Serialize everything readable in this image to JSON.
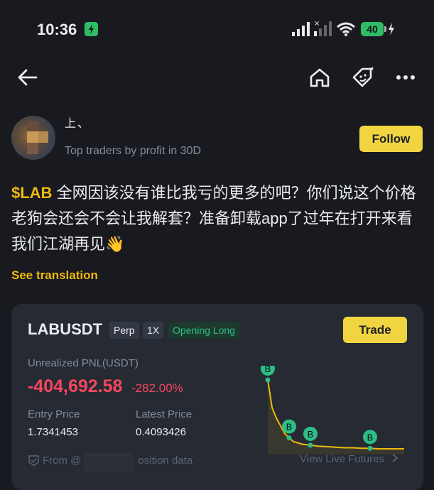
{
  "status_bar": {
    "time": "10:36",
    "battery": "40"
  },
  "nav": {
    "back_icon": "arrow-left-icon",
    "home_icon": "home-icon",
    "tipping_icon": "tag-face-icon",
    "more_icon": "more-dots-icon"
  },
  "author": {
    "name": "上、",
    "subtitle": "Top traders by profit in 30D",
    "follow_label": "Follow"
  },
  "post": {
    "tag": "$LAB",
    "text": " 全网因该没有谁比我亏的更多的吧？你们说这个价格老狗会还会不会让我解套？准备卸载app了过年在打开来看我们江湖再见",
    "emoji": "👋",
    "see_translation": "See translation"
  },
  "position_card": {
    "symbol": "LABUSDT",
    "type_pill": "Perp",
    "leverage_pill": "1X",
    "status_pill": "Opening Long",
    "trade_label": "Trade",
    "pnl_label": "Unrealized PNL(USDT)",
    "pnl_value": "-404,692.58",
    "pnl_pct": "-282.00%",
    "entry_label": "Entry Price",
    "entry_value": "1.7341453",
    "latest_label": "Latest Price",
    "latest_value": "0.4093426",
    "from_text": "From @",
    "from_suffix": "osition data",
    "view_live": "View Live Futures",
    "colors": {
      "accent": "#f0d541",
      "loss": "#f6465d",
      "long": "#2ebd85"
    }
  },
  "mini_chart": {
    "marker_label": "B",
    "price_trend": [
      1.73,
      1.2,
      1.0,
      0.85,
      0.7,
      0.62,
      0.55,
      0.5,
      0.48,
      0.46,
      0.45,
      0.44,
      0.43,
      0.43,
      0.42,
      0.42,
      0.41,
      0.41,
      0.41,
      0.41
    ]
  }
}
